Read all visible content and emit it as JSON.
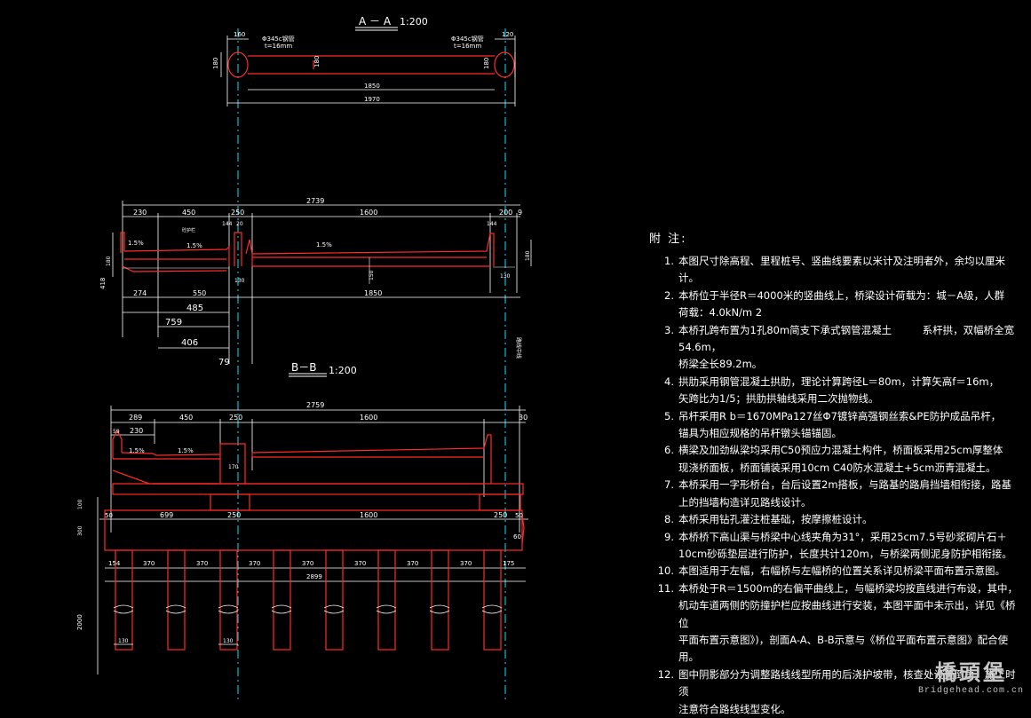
{
  "sections": {
    "aa_title": "A － A",
    "aa_scale": "1:200",
    "bb_title": "B－B",
    "bb_scale": "1:200"
  },
  "aa_dims": {
    "d160": "160",
    "d120": "120",
    "d180a": "180",
    "d180b": "180",
    "d180c": "180",
    "d1850": "1850",
    "d1970": "1970",
    "pipe_left_1": "Φ345c钢管",
    "pipe_left_2": "t=16mm",
    "pipe_right_1": "Φ345c钢管",
    "pipe_right_2": "t=16mm"
  },
  "mid_dims": {
    "d2739": "2739",
    "d230": "230",
    "d450": "450",
    "d250": "250",
    "d1600": "1600",
    "d200": "200",
    "d9": "9",
    "d144a": "144",
    "d20": "20",
    "d144b": "144",
    "d1_5a": "1.5%",
    "d1_5b": "1.5%",
    "d1_5c": "1.5%",
    "label_rail": "砼护栏",
    "d418": "418",
    "d180": "180",
    "d130a": "130",
    "d130b": "130",
    "d180r": "180",
    "d150": "150",
    "d274": "274",
    "d550": "550",
    "d1850": "1850",
    "d485": "485",
    "d759": "759",
    "d406": "406",
    "d79": "79"
  },
  "bb_dims": {
    "d2759": "2759",
    "d289": "289",
    "d450": "450",
    "d250": "250",
    "d1600": "1600",
    "d30": "30",
    "d59": "59",
    "d230": "230",
    "d1_5a": "1.5%",
    "d1_5b": "1.5%",
    "d170": "170",
    "d100": "100",
    "d300": "300",
    "d50a": "50",
    "d699": "699",
    "d250b": "250",
    "d1600b": "1600",
    "d250c": "250",
    "d50b": "50",
    "d60": "60",
    "pile_dims": [
      "154",
      "370",
      "370",
      "370",
      "370",
      "370",
      "370",
      "370",
      "175"
    ],
    "d2899": "2899",
    "d2000": "2000",
    "d130a": "130",
    "d130b": "130",
    "vlabel": "路线中线"
  },
  "notes_title": "附 注:",
  "notes": [
    {
      "num": "1.",
      "lines": [
        "本图尺寸除高程、里程桩号、竖曲线要素以米计及注明者外，余均以厘米计。"
      ]
    },
    {
      "num": "2.",
      "lines": [
        "本桥位于半径R＝4000米的竖曲线上，桥梁设计荷载为：城－A级，人群",
        "荷载：4.0kN/m  2"
      ]
    },
    {
      "num": "3.",
      "lines": [
        "本桥孔跨布置为1孔80m简支下承式钢管混凝土　　　系杆拱，双幅桥全宽54.6m，",
        "桥梁全长89.2m。"
      ]
    },
    {
      "num": "4.",
      "lines": [
        "拱肋采用钢管混凝土拱肋，理论计算跨径L＝80m，计算矢高f＝16m，",
        "矢跨比为1/5；拱肋拱轴线采用二次抛物线。"
      ]
    },
    {
      "num": "5.",
      "lines": [
        "吊杆采用R  b＝1670MPa127丝Φ7镀锌高强钢丝索&PE防护成品吊杆，",
        "锚具为相应规格的吊杆镦头锚锚固。"
      ]
    },
    {
      "num": "6.",
      "lines": [
        "横梁及加劲纵梁均采用C50预应力混凝土构件，桥面板采用25cm厚整体",
        "现浇桥面板，桥面铺装采用10cm C40防水混凝土+5cm沥青混凝土。"
      ]
    },
    {
      "num": "7.",
      "lines": [
        "本桥采用一字形桥台，台后设置2m搭板，与路基的路肩挡墙相衔接，路基",
        "上的挡墙构造详见路线设计。"
      ]
    },
    {
      "num": "8.",
      "lines": [
        "本桥采用钻孔灌注桩基础，按摩擦桩设计。"
      ]
    },
    {
      "num": "9.",
      "lines": [
        "本桥桥下高山渠与桥梁中心线夹角为31°，采用25cm7.5号砂浆砌片石＋",
        "10cm砂砾垫层进行防护，长度共计120m，与桥梁两侧泥身防护相衔接。"
      ]
    },
    {
      "num": "10.",
      "lines": [
        "本图适用于左幅，右幅桥与左幅桥的位置关系详见桥梁平面布置示意图。"
      ]
    },
    {
      "num": "11.",
      "lines": [
        "本桥处于R＝1500m的右偏平曲线上，与幅桥梁均按直线进行布设，其中，",
        "机动车道两侧的防撞护栏应按曲线进行安装，本图平面中未示出，详见《桥位",
        "平面布置示意图》)，剖面A-A、B-B示意与《桥位平面布置示意图》配合使用。"
      ]
    },
    {
      "num": "12.",
      "lines": [
        "图中阴影部分为调整路线线型所用的后浇护坡带，核查处设置倒角，施工时须",
        "注意符合路线线型变化。"
      ]
    }
  ],
  "watermark": {
    "cn": "橋頭堡",
    "en": "Bridgehead.com.cn"
  },
  "colors": {
    "background": "#000000",
    "line": "#ffffff",
    "structure": "#ff2a2a",
    "axis": "#00ffff",
    "dim": "#ffffff"
  }
}
